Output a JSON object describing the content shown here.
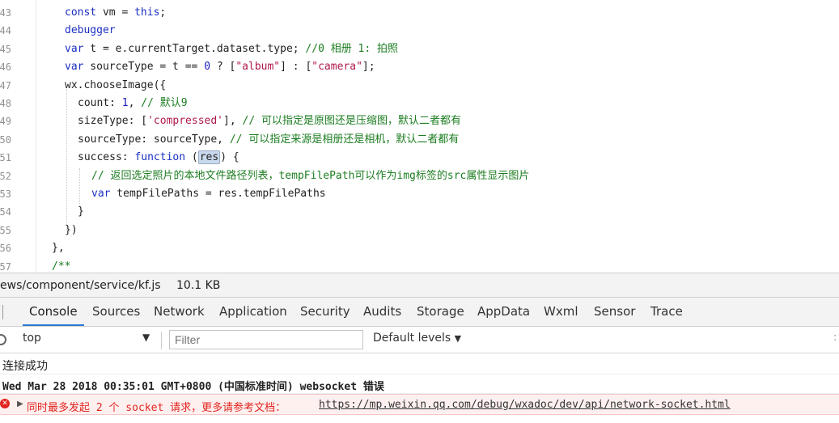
{
  "editor": {
    "line_numbers": [
      "43",
      "44",
      "45",
      "46",
      "47",
      "48",
      "49",
      "50",
      "51",
      "52",
      "53",
      "54",
      "55",
      "56",
      "57"
    ],
    "lines": [
      [
        {
          "t": "kw2",
          "v": "const"
        },
        {
          "t": "pl",
          "v": " vm = "
        },
        {
          "t": "kw2",
          "v": "this"
        },
        {
          "t": "pl",
          "v": ";"
        }
      ],
      [
        {
          "t": "kw2",
          "v": "debugger"
        }
      ],
      [
        {
          "t": "kw2",
          "v": "var"
        },
        {
          "t": "pl",
          "v": " t = e.currentTarget.dataset.type; "
        },
        {
          "t": "cm",
          "v": "//0 相册 1: 拍照"
        }
      ],
      [
        {
          "t": "kw2",
          "v": "var"
        },
        {
          "t": "pl",
          "v": " sourceType = t == "
        },
        {
          "t": "num",
          "v": "0"
        },
        {
          "t": "pl",
          "v": " ? ["
        },
        {
          "t": "str",
          "v": "\"album\""
        },
        {
          "t": "pl",
          "v": "] : ["
        },
        {
          "t": "str",
          "v": "\"camera\""
        },
        {
          "t": "pl",
          "v": "];"
        }
      ],
      [
        {
          "t": "pl",
          "v": "wx.chooseImage({"
        }
      ],
      [
        {
          "t": "pl",
          "v": "count: "
        },
        {
          "t": "num",
          "v": "1"
        },
        {
          "t": "pl",
          "v": ", "
        },
        {
          "t": "cm",
          "v": "// 默认9"
        }
      ],
      [
        {
          "t": "pl",
          "v": "sizeType: ["
        },
        {
          "t": "str",
          "v": "'compressed'"
        },
        {
          "t": "pl",
          "v": "], "
        },
        {
          "t": "cm",
          "v": "// 可以指定是原图还是压缩图，默认二者都有"
        }
      ],
      [
        {
          "t": "pl",
          "v": "sourceType: sourceType, "
        },
        {
          "t": "cm",
          "v": "// 可以指定来源是相册还是相机，默认二者都有"
        }
      ],
      [
        {
          "t": "pl",
          "v": "success: "
        },
        {
          "t": "kw2",
          "v": "function"
        },
        {
          "t": "pl",
          "v": " ("
        },
        {
          "t": "hl",
          "v": "res"
        },
        {
          "t": "pl",
          "v": ") {"
        }
      ],
      [
        {
          "t": "cm",
          "v": "// 返回选定照片的本地文件路径列表，tempFilePath可以作为img标签的src属性显示图片"
        }
      ],
      [
        {
          "t": "kw2",
          "v": "var"
        },
        {
          "t": "pl",
          "v": " tempFilePaths = res.tempFilePaths"
        }
      ],
      [
        {
          "t": "pl",
          "v": "}"
        }
      ],
      [
        {
          "t": "pl",
          "v": "})"
        }
      ],
      [
        {
          "t": "pl",
          "v": "},"
        }
      ],
      [
        {
          "t": "cm",
          "v": "/**"
        }
      ]
    ]
  },
  "status": {
    "file_path": "ews/component/service/kf.js",
    "file_size": "10.1 KB"
  },
  "tabs": [
    {
      "label": "Console",
      "active": true
    },
    {
      "label": "Sources"
    },
    {
      "label": "Network"
    },
    {
      "label": "Application"
    },
    {
      "label": "Security"
    },
    {
      "label": "Audits"
    },
    {
      "label": "Storage"
    },
    {
      "label": "AppData"
    },
    {
      "label": "Wxml"
    },
    {
      "label": "Sensor"
    },
    {
      "label": "Trace"
    }
  ],
  "toolbar": {
    "context": "top",
    "context_arrow": "▼",
    "filter_placeholder": "Filter",
    "levels_label": "Default levels",
    "levels_arrow": "▼",
    "right_marker": ":"
  },
  "console": {
    "msg_success": "连接成功",
    "msg_error_time": "Wed Mar 28 2018 00:35:01 GMT+0800 (中国标准时间) websocket 错误",
    "err_icon": "✕",
    "err_expander": "▶",
    "err_text": "同时最多发起 2 个 socket 请求，更多请参考文档：",
    "err_link": "https://mp.weixin.qq.com/debug/wxadoc/dev/api/network-socket.html"
  },
  "colors": {
    "active_tab_underline": "#2a7ad4",
    "error_red": "#e0261f",
    "error_bg": "#fff0f0"
  }
}
